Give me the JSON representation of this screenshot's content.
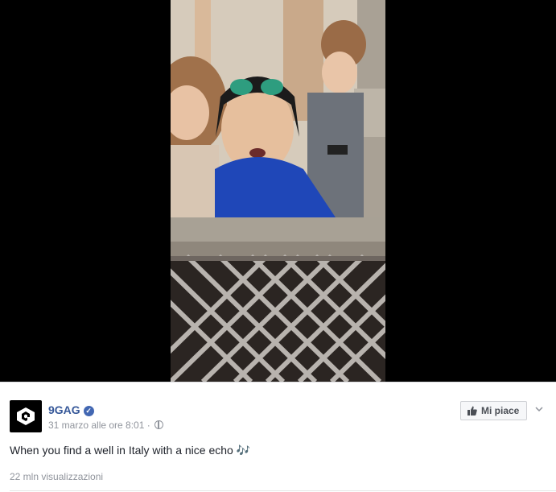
{
  "video": {
    "description_icon": "video-frame-icon"
  },
  "post": {
    "page_name": "9GAG",
    "verified_icon": "verified-badge-icon",
    "timestamp": "31 marzo alle ore 8:01",
    "separator": "·",
    "privacy_icon": "globe-icon",
    "like_label": "Mi piace",
    "like_icon": "thumbs-up-icon",
    "menu_icon": "chevron-down-icon",
    "text": "When you find a well in Italy with a nice echo 🎶",
    "views": "22 mln visualizzazioni"
  },
  "colors": {
    "link": "#365899",
    "meta": "#90949c",
    "text": "#1d2129",
    "background": "#e9ebee"
  }
}
